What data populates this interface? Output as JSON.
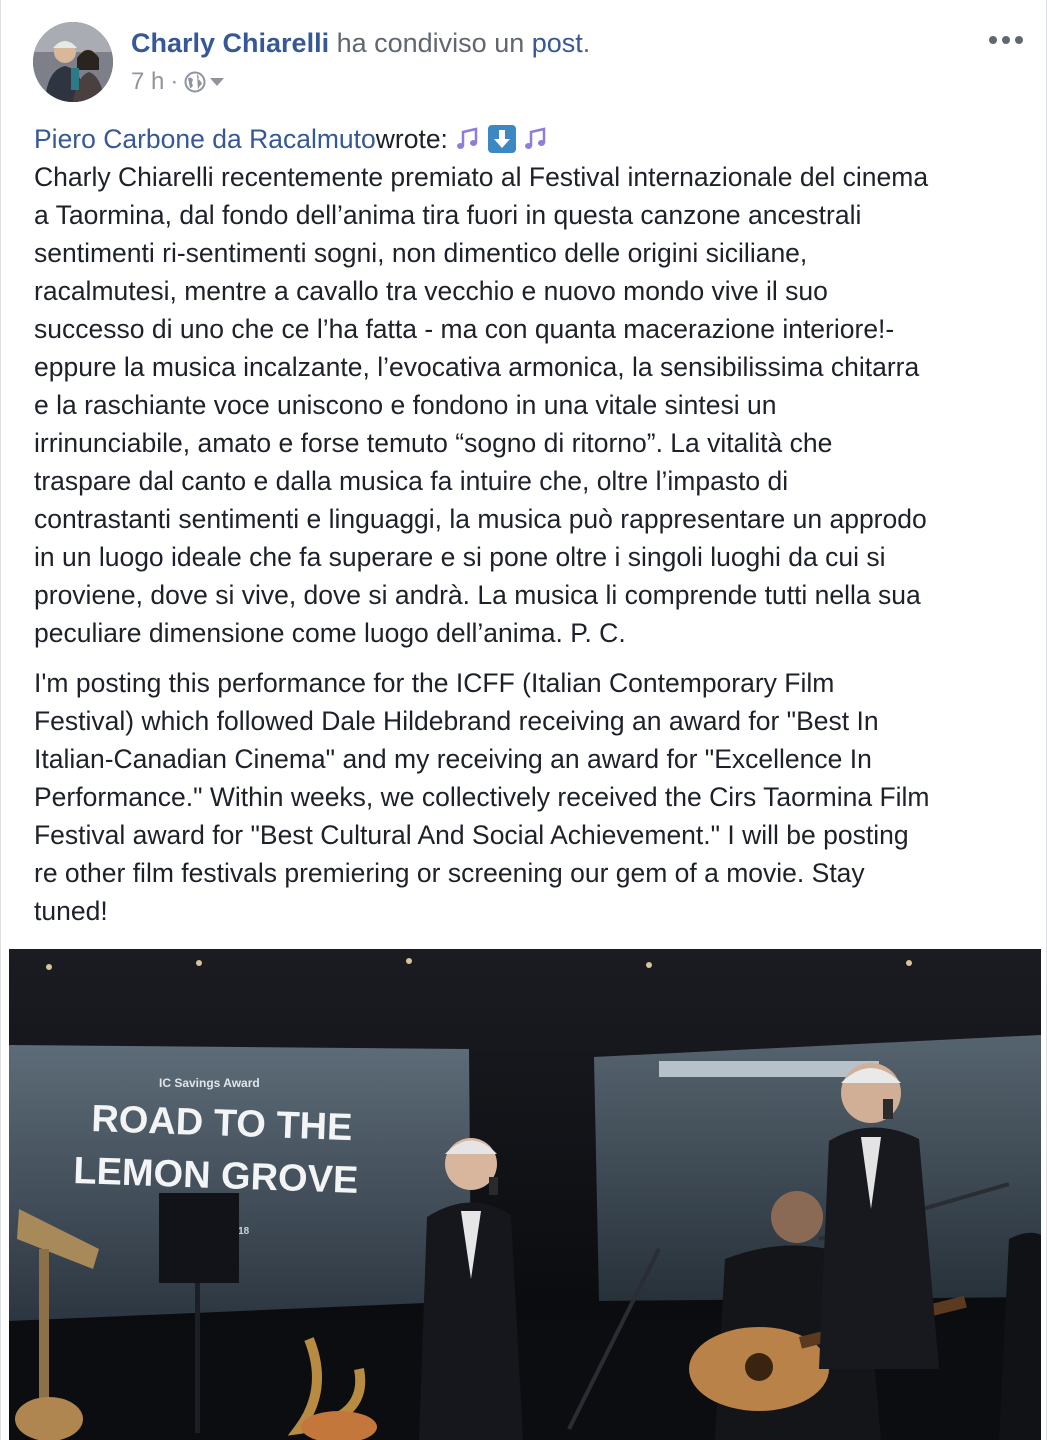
{
  "post": {
    "author": "Charly Chiarelli",
    "shared_text": "ha condiviso un",
    "post_word": "post",
    "period": ".",
    "time": "7 h",
    "dot": "·",
    "more_icon": "ellipsis-icon",
    "privacy_icon": "globe-icon"
  },
  "content": {
    "shared_author": "Piero Carbone da Racalmuto",
    "wrote": " wrote:",
    "emojis": [
      "musical-notes-icon",
      "down-arrow-icon",
      "musical-notes-icon"
    ],
    "paragraph1_lines": [
      "Charly Chiarelli recentemente premiato al Festival internazionale del cinema",
      "a Taormina, dal fondo dell’anima tira fuori in questa canzone ancestrali",
      "sentimenti ri-sentimenti sogni, non dimentico delle origini siciliane,",
      "racalmutesi, mentre a cavallo tra vecchio e nuovo mondo vive il suo",
      "successo di uno che ce l’ha fatta - ma con quanta macerazione interiore!-",
      "eppure la musica incalzante, l’evocativa armonica, la sensibilissima chitarra",
      "e la raschiante voce uniscono e fondono in una vitale sintesi un",
      "irrinunciabile, amato e forse temuto “sogno di ritorno”. La vitalità che",
      "traspare dal canto e dalla musica fa intuire che, oltre l’impasto di",
      "contrastanti sentimenti e linguaggi, la musica può rappresentare un approdo",
      "in un luogo ideale che fa superare e si pone oltre i singoli luoghi da cui si",
      "proviene, dove si vive, dove si andrà. La musica li comprende tutti nella sua",
      "peculiare dimensione come luogo dell’anima. P. C."
    ],
    "paragraph2_lines": [
      "I'm posting this performance for the ICFF (Italian Contemporary Film",
      "Festival) which followed Dale Hildebrand receiving an award for \"Best In",
      "Italian-Canadian Cinema\" and my receiving an award for \"Excellence In",
      "Performance.\" Within weeks, we collectively received the Cirs Taormina Film",
      "Festival award for \"Best Cultural And Social Achievement.\" I will be posting",
      "re other film festivals premiering or screening our gem of a movie. Stay",
      "tuned!"
    ]
  },
  "video": {
    "screen_small": "IC Savings Award",
    "screen_title_1": "ROAD TO THE",
    "screen_title_2": "LEMON GROVE",
    "screen_date": "2018"
  },
  "colors": {
    "link": "#365899",
    "text": "#1d2129",
    "meta": "#90949c",
    "emoji_bg": "#8b7fd9",
    "arrow_bg": "#3b88c3"
  }
}
